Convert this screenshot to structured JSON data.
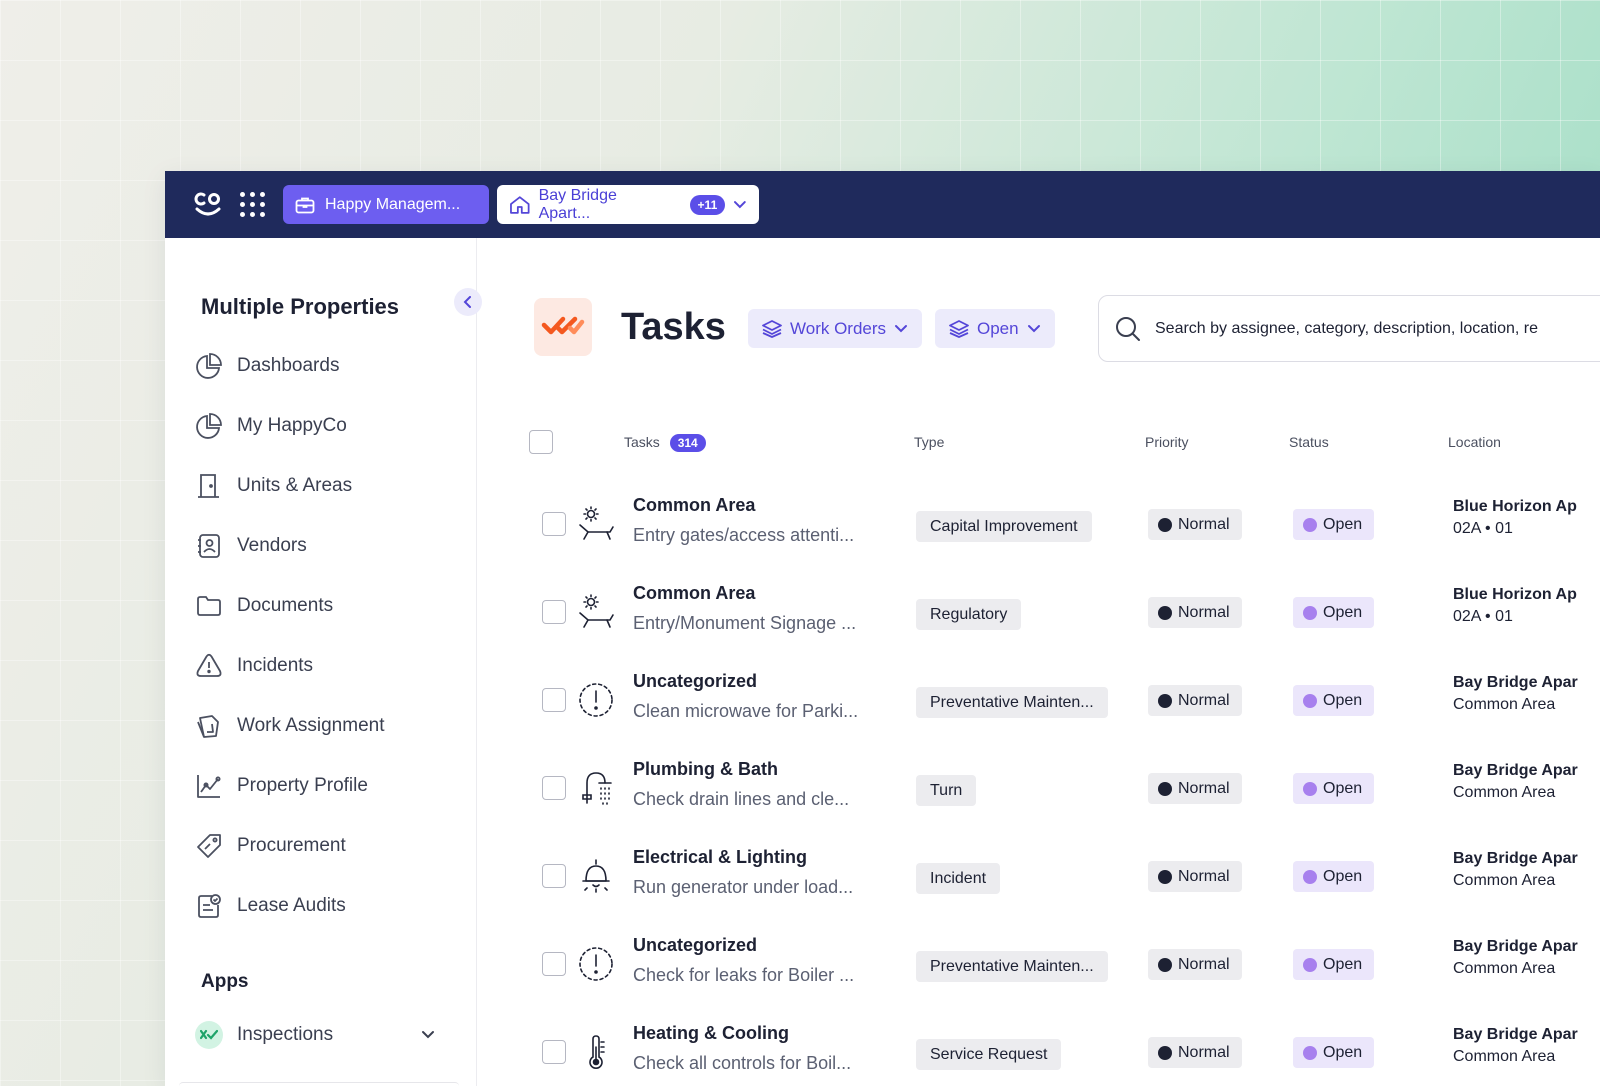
{
  "topbar": {
    "org_label": "Happy Managem...",
    "property_label": "Bay Bridge Apart...",
    "property_count": "+11",
    "colors": {
      "bar": "#1f2a5c",
      "accent": "#6d5ef0"
    }
  },
  "sidebar": {
    "title": "Multiple Properties",
    "items": [
      {
        "label": "Dashboards",
        "icon": "pie-chart-icon"
      },
      {
        "label": "My HappyCo",
        "icon": "pie-chart-icon"
      },
      {
        "label": "Units & Areas",
        "icon": "door-icon"
      },
      {
        "label": "Vendors",
        "icon": "contacts-icon"
      },
      {
        "label": "Documents",
        "icon": "folder-icon"
      },
      {
        "label": "Incidents",
        "icon": "warning-icon"
      },
      {
        "label": "Work Assignment",
        "icon": "assignment-icon"
      },
      {
        "label": "Property Profile",
        "icon": "line-chart-icon"
      },
      {
        "label": "Procurement",
        "icon": "tag-icon"
      },
      {
        "label": "Lease Audits",
        "icon": "audit-icon"
      }
    ],
    "apps_title": "Apps",
    "apps": [
      {
        "label": "Inspections",
        "icon": "inspections-icon"
      }
    ]
  },
  "main": {
    "title": "Tasks",
    "filters": [
      {
        "label": "Work Orders",
        "icon": "layers-icon"
      },
      {
        "label": "Open",
        "icon": "layers-icon"
      }
    ],
    "search": {
      "placeholder": "Search by assignee, category, description, location, re"
    },
    "table": {
      "headers": {
        "tasks": "Tasks",
        "tasks_count": "314",
        "type": "Type",
        "priority": "Priority",
        "status": "Status",
        "location": "Location"
      },
      "rows": [
        {
          "category": "Common Area",
          "description": "Entry gates/access attenti...",
          "type": "Capital Improvement",
          "priority": "Normal",
          "status": "Open",
          "location": "Blue Horizon Ap",
          "sublocation": "02A • 01",
          "icon": "lounge-chair-icon"
        },
        {
          "category": "Common Area",
          "description": "Entry/Monument Signage ...",
          "type": "Regulatory",
          "priority": "Normal",
          "status": "Open",
          "location": "Blue Horizon Ap",
          "sublocation": "02A • 01",
          "icon": "lounge-chair-icon"
        },
        {
          "category": "Uncategorized",
          "description": "Clean microwave for Parki...",
          "type": "Preventative Mainten...",
          "priority": "Normal",
          "status": "Open",
          "location": "Bay Bridge Apar",
          "sublocation": "Common Area",
          "icon": "alert-circle-icon"
        },
        {
          "category": "Plumbing & Bath",
          "description": "Check drain lines and cle...",
          "type": "Turn",
          "priority": "Normal",
          "status": "Open",
          "location": "Bay Bridge Apar",
          "sublocation": "Common Area",
          "icon": "shower-icon"
        },
        {
          "category": "Electrical & Lighting",
          "description": "Run generator under load...",
          "type": "Incident",
          "priority": "Normal",
          "status": "Open",
          "location": "Bay Bridge Apar",
          "sublocation": "Common Area",
          "icon": "lamp-icon"
        },
        {
          "category": "Uncategorized",
          "description": "Check for leaks for Boiler ...",
          "type": "Preventative Mainten...",
          "priority": "Normal",
          "status": "Open",
          "location": "Bay Bridge Apar",
          "sublocation": "Common Area",
          "icon": "alert-circle-icon"
        },
        {
          "category": "Heating & Cooling",
          "description": "Check all controls for Boil...",
          "type": "Service Request",
          "priority": "Normal",
          "status": "Open",
          "location": "Bay Bridge Apar",
          "sublocation": "Common Area",
          "icon": "thermometer-icon"
        }
      ]
    }
  }
}
